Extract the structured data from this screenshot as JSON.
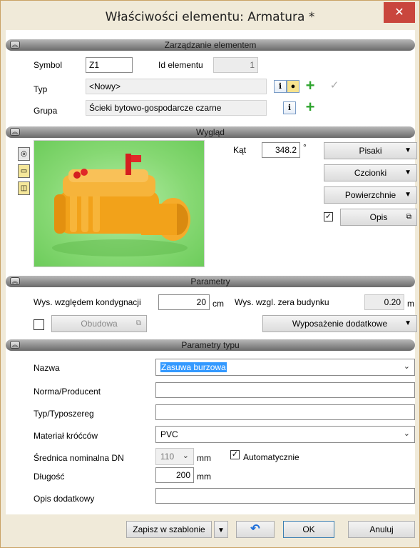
{
  "window": {
    "title": "Właściwości elementu: Armatura *",
    "close": "✕"
  },
  "sections": {
    "management": "Zarządzanie elementem",
    "appearance": "Wygląd",
    "parameters": "Parametry",
    "type_parameters": "Parametry typu"
  },
  "management": {
    "symbol_label": "Symbol",
    "symbol_value": "Z1",
    "id_label": "Id elementu",
    "id_value": "1",
    "type_label": "Typ",
    "type_value": "<Nowy>",
    "group_label": "Grupa",
    "group_value": "Ścieki bytowo-gospodarcze czarne"
  },
  "appearance": {
    "angle_label": "Kąt",
    "angle_value": "348.2",
    "angle_unit": "°",
    "pens_button": "Pisaki",
    "fonts_button": "Czcionki",
    "surfaces_button": "Powierzchnie",
    "description_button": "Opis",
    "description_checked": true
  },
  "parameters": {
    "storey_height_label": "Wys. względem kondygnacji",
    "storey_height_value": "20",
    "storey_height_unit": "cm",
    "zero_height_label": "Wys. wzgl. zera budynku",
    "zero_height_value": "0.20",
    "zero_height_unit": "m",
    "housing_button": "Obudowa",
    "housing_checked": false,
    "extra_equipment_button": "Wyposażenie dodatkowe"
  },
  "type_parameters": {
    "name_label": "Nazwa",
    "name_value": "Zasuwa burzowa",
    "norm_label": "Norma/Producent",
    "norm_value": "",
    "series_label": "Typ/Typoszereg",
    "series_value": "",
    "material_label": "Materiał króćców",
    "material_value": "PVC",
    "dn_label": "Średnica nominalna DN",
    "dn_value": "110",
    "dn_unit": "mm",
    "auto_label": "Automatycznie",
    "auto_checked": true,
    "length_label": "Długość",
    "length_value": "200",
    "length_unit": "mm",
    "extra_desc_label": "Opis dodatkowy",
    "extra_desc_value": ""
  },
  "footer": {
    "save_template": "Zapisz w szablonie",
    "ok": "OK",
    "cancel": "Anuluj"
  },
  "colors": {
    "accent": "#3399ff",
    "close_bg": "#c9463d",
    "window_frame": "#f0ead9",
    "plus_green": "#2fa52f"
  }
}
